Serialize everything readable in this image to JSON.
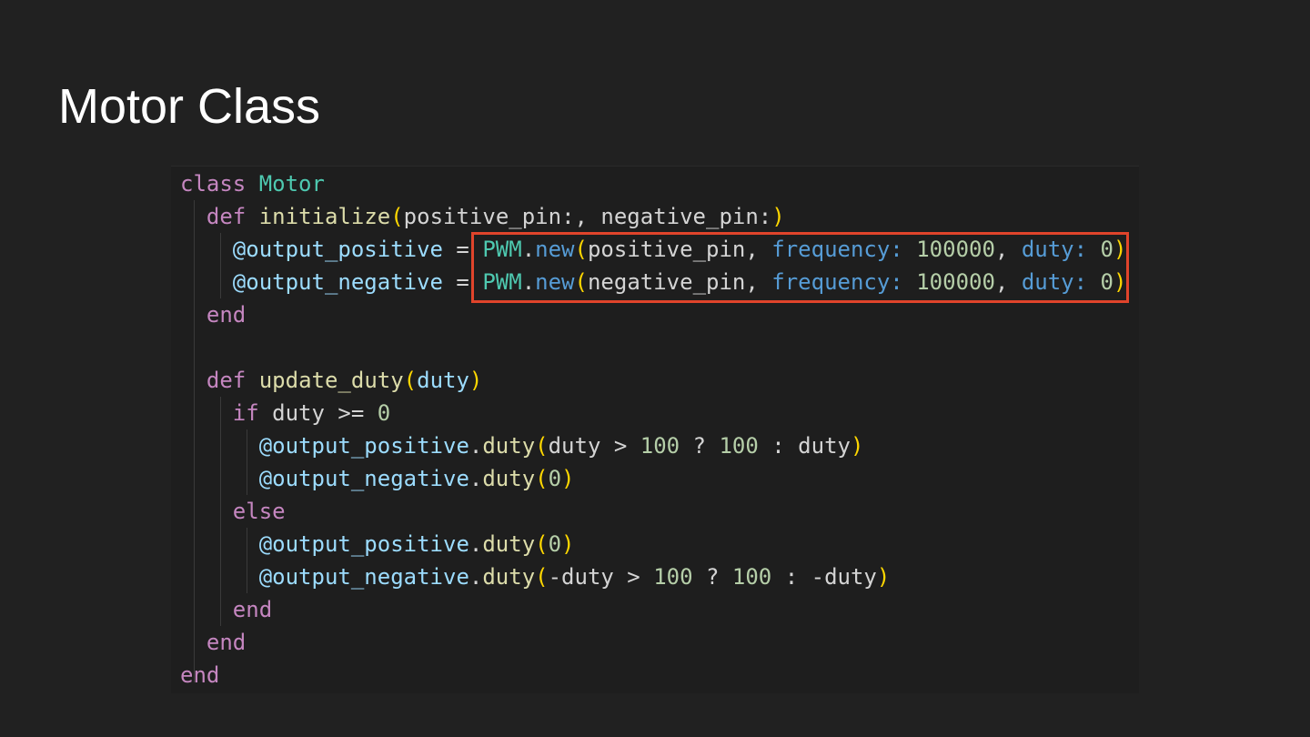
{
  "slide": {
    "title": "Motor Class"
  },
  "colors": {
    "background": "#212121",
    "code_background": "#1e1e1e",
    "keyword": "#c586c0",
    "class_name": "#4ec9b0",
    "method": "#dcdcaa",
    "param": "#9cdcfe",
    "default_text": "#d4d4d4",
    "symbol_key": "#569cd6",
    "number": "#b5cea8",
    "bracket": "#ffd700",
    "highlight_border": "#e0442b"
  },
  "code": {
    "language": "ruby",
    "lines": [
      [
        {
          "t": "class",
          "c": "keyword"
        },
        {
          "t": " ",
          "c": "default_text"
        },
        {
          "t": "Motor",
          "c": "class_name"
        }
      ],
      [
        {
          "t": "  ",
          "c": "default_text"
        },
        {
          "t": "def",
          "c": "keyword"
        },
        {
          "t": " ",
          "c": "default_text"
        },
        {
          "t": "initialize",
          "c": "method"
        },
        {
          "t": "(",
          "c": "bracket"
        },
        {
          "t": "positive_pin:, negative_pin:",
          "c": "default_text"
        },
        {
          "t": ")",
          "c": "bracket"
        }
      ],
      [
        {
          "t": "    ",
          "c": "default_text"
        },
        {
          "t": "@output_positive",
          "c": "param"
        },
        {
          "t": " = ",
          "c": "default_text"
        },
        {
          "t": "PWM",
          "c": "class_name"
        },
        {
          "t": ".",
          "c": "default_text"
        },
        {
          "t": "new",
          "c": "symbol_key"
        },
        {
          "t": "(",
          "c": "bracket"
        },
        {
          "t": "positive_pin, ",
          "c": "default_text"
        },
        {
          "t": "frequency:",
          "c": "symbol_key"
        },
        {
          "t": " ",
          "c": "default_text"
        },
        {
          "t": "100000",
          "c": "number"
        },
        {
          "t": ", ",
          "c": "default_text"
        },
        {
          "t": "duty:",
          "c": "symbol_key"
        },
        {
          "t": " ",
          "c": "default_text"
        },
        {
          "t": "0",
          "c": "number"
        },
        {
          "t": ")",
          "c": "bracket"
        }
      ],
      [
        {
          "t": "    ",
          "c": "default_text"
        },
        {
          "t": "@output_negative",
          "c": "param"
        },
        {
          "t": " = ",
          "c": "default_text"
        },
        {
          "t": "PWM",
          "c": "class_name"
        },
        {
          "t": ".",
          "c": "default_text"
        },
        {
          "t": "new",
          "c": "symbol_key"
        },
        {
          "t": "(",
          "c": "bracket"
        },
        {
          "t": "negative_pin, ",
          "c": "default_text"
        },
        {
          "t": "frequency:",
          "c": "symbol_key"
        },
        {
          "t": " ",
          "c": "default_text"
        },
        {
          "t": "100000",
          "c": "number"
        },
        {
          "t": ", ",
          "c": "default_text"
        },
        {
          "t": "duty:",
          "c": "symbol_key"
        },
        {
          "t": " ",
          "c": "default_text"
        },
        {
          "t": "0",
          "c": "number"
        },
        {
          "t": ")",
          "c": "bracket"
        }
      ],
      [
        {
          "t": "  ",
          "c": "default_text"
        },
        {
          "t": "end",
          "c": "keyword"
        }
      ],
      [
        {
          "t": "",
          "c": "default_text"
        }
      ],
      [
        {
          "t": "  ",
          "c": "default_text"
        },
        {
          "t": "def",
          "c": "keyword"
        },
        {
          "t": " ",
          "c": "default_text"
        },
        {
          "t": "update_duty",
          "c": "method"
        },
        {
          "t": "(",
          "c": "bracket"
        },
        {
          "t": "duty",
          "c": "param"
        },
        {
          "t": ")",
          "c": "bracket"
        }
      ],
      [
        {
          "t": "    ",
          "c": "default_text"
        },
        {
          "t": "if",
          "c": "keyword"
        },
        {
          "t": " duty >= ",
          "c": "default_text"
        },
        {
          "t": "0",
          "c": "number"
        }
      ],
      [
        {
          "t": "      ",
          "c": "default_text"
        },
        {
          "t": "@output_positive",
          "c": "param"
        },
        {
          "t": ".",
          "c": "default_text"
        },
        {
          "t": "duty",
          "c": "method"
        },
        {
          "t": "(",
          "c": "bracket"
        },
        {
          "t": "duty > ",
          "c": "default_text"
        },
        {
          "t": "100",
          "c": "number"
        },
        {
          "t": " ? ",
          "c": "default_text"
        },
        {
          "t": "100",
          "c": "number"
        },
        {
          "t": " : duty",
          "c": "default_text"
        },
        {
          "t": ")",
          "c": "bracket"
        }
      ],
      [
        {
          "t": "      ",
          "c": "default_text"
        },
        {
          "t": "@output_negative",
          "c": "param"
        },
        {
          "t": ".",
          "c": "default_text"
        },
        {
          "t": "duty",
          "c": "method"
        },
        {
          "t": "(",
          "c": "bracket"
        },
        {
          "t": "0",
          "c": "number"
        },
        {
          "t": ")",
          "c": "bracket"
        }
      ],
      [
        {
          "t": "    ",
          "c": "default_text"
        },
        {
          "t": "else",
          "c": "keyword"
        }
      ],
      [
        {
          "t": "      ",
          "c": "default_text"
        },
        {
          "t": "@output_positive",
          "c": "param"
        },
        {
          "t": ".",
          "c": "default_text"
        },
        {
          "t": "duty",
          "c": "method"
        },
        {
          "t": "(",
          "c": "bracket"
        },
        {
          "t": "0",
          "c": "number"
        },
        {
          "t": ")",
          "c": "bracket"
        }
      ],
      [
        {
          "t": "      ",
          "c": "default_text"
        },
        {
          "t": "@output_negative",
          "c": "param"
        },
        {
          "t": ".",
          "c": "default_text"
        },
        {
          "t": "duty",
          "c": "method"
        },
        {
          "t": "(",
          "c": "bracket"
        },
        {
          "t": "-duty > ",
          "c": "default_text"
        },
        {
          "t": "100",
          "c": "number"
        },
        {
          "t": " ? ",
          "c": "default_text"
        },
        {
          "t": "100",
          "c": "number"
        },
        {
          "t": " : -duty",
          "c": "default_text"
        },
        {
          "t": ")",
          "c": "bracket"
        }
      ],
      [
        {
          "t": "    ",
          "c": "default_text"
        },
        {
          "t": "end",
          "c": "keyword"
        }
      ],
      [
        {
          "t": "  ",
          "c": "default_text"
        },
        {
          "t": "end",
          "c": "keyword"
        }
      ],
      [
        {
          "t": "end",
          "c": "keyword"
        }
      ]
    ]
  }
}
